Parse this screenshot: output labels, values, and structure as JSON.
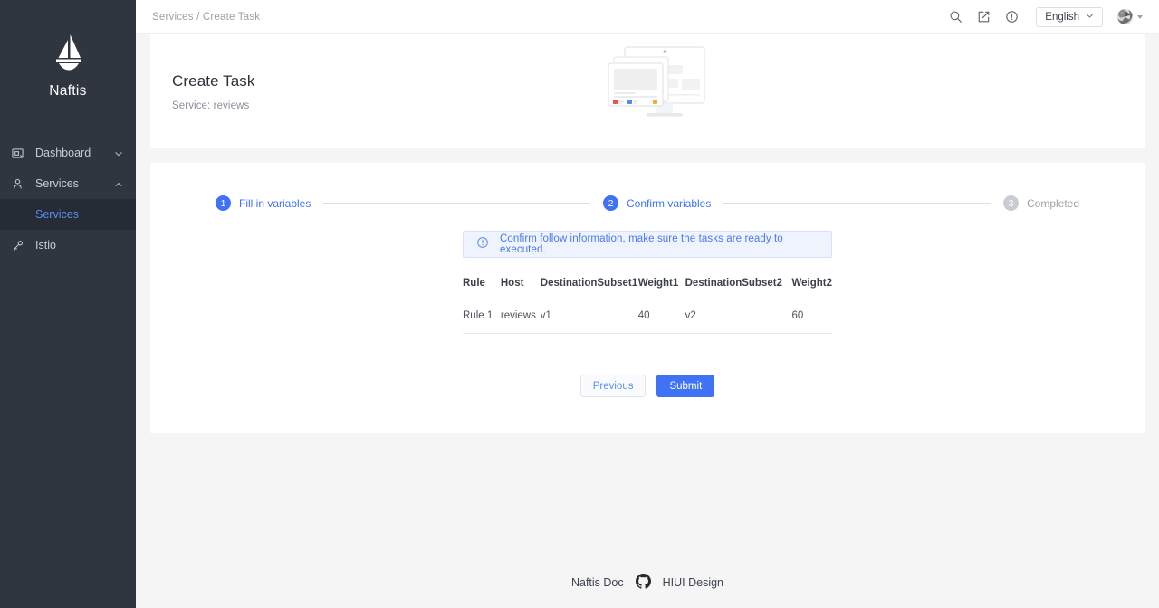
{
  "sidebar": {
    "brand": {
      "name": "Naftis",
      "logo_icon": "sailboat-icon"
    },
    "items": [
      {
        "label": "Dashboard",
        "icon": "monitor-icon",
        "chevron": "chevron-down-icon"
      },
      {
        "label": "Services",
        "icon": "user-icon",
        "chevron": "chevron-up-icon"
      },
      {
        "label": "Istio",
        "icon": "key-icon",
        "chevron": ""
      }
    ],
    "sub_items": [
      {
        "label": "Services",
        "active": true
      }
    ],
    "colors": {
      "bg": "#2f3640",
      "active_bg": "#262c35",
      "active_text": "#5a8dee"
    }
  },
  "topbar": {
    "breadcrumb": "Services / Create Task",
    "icons": [
      "search-icon",
      "edit-square-icon",
      "info-circle-icon"
    ],
    "language": {
      "label": "English",
      "chevron": "chevron-down-icon"
    },
    "avatar": "user-avatar"
  },
  "header_card": {
    "title": "Create Task",
    "subtitle": "Service: reviews",
    "illustration": "monitor-windows-illustration"
  },
  "steps": [
    {
      "number": "1",
      "label": "Fill in variables",
      "state": "active"
    },
    {
      "number": "2",
      "label": "Confirm variables",
      "state": "active"
    },
    {
      "number": "3",
      "label": "Completed",
      "state": "inactive"
    }
  ],
  "alert": {
    "icon": "info-circle-icon",
    "text": "Confirm follow information, make sure the tasks are ready to executed."
  },
  "table": {
    "columns": [
      "Rule",
      "Host",
      "DestinationSubset1",
      "Weight1",
      "DestinationSubset2",
      "Weight2"
    ],
    "rows": [
      {
        "rule": "Rule 1",
        "host": "reviews",
        "destination_subset1": "v1",
        "weight1": "40",
        "destination_subset2": "v2",
        "weight2": "60"
      }
    ]
  },
  "actions": {
    "previous_label": "Previous",
    "submit_label": "Submit"
  },
  "footer": {
    "doc_label": "Naftis Doc",
    "github_icon": "github-icon",
    "design_label": "HIUI Design"
  },
  "colors": {
    "primary": "#3f72f5",
    "link": "#5a8dee",
    "page_bg": "#f5f5f5",
    "sidebar_bg": "#2f3640",
    "alert_bg": "#eef3fe"
  }
}
